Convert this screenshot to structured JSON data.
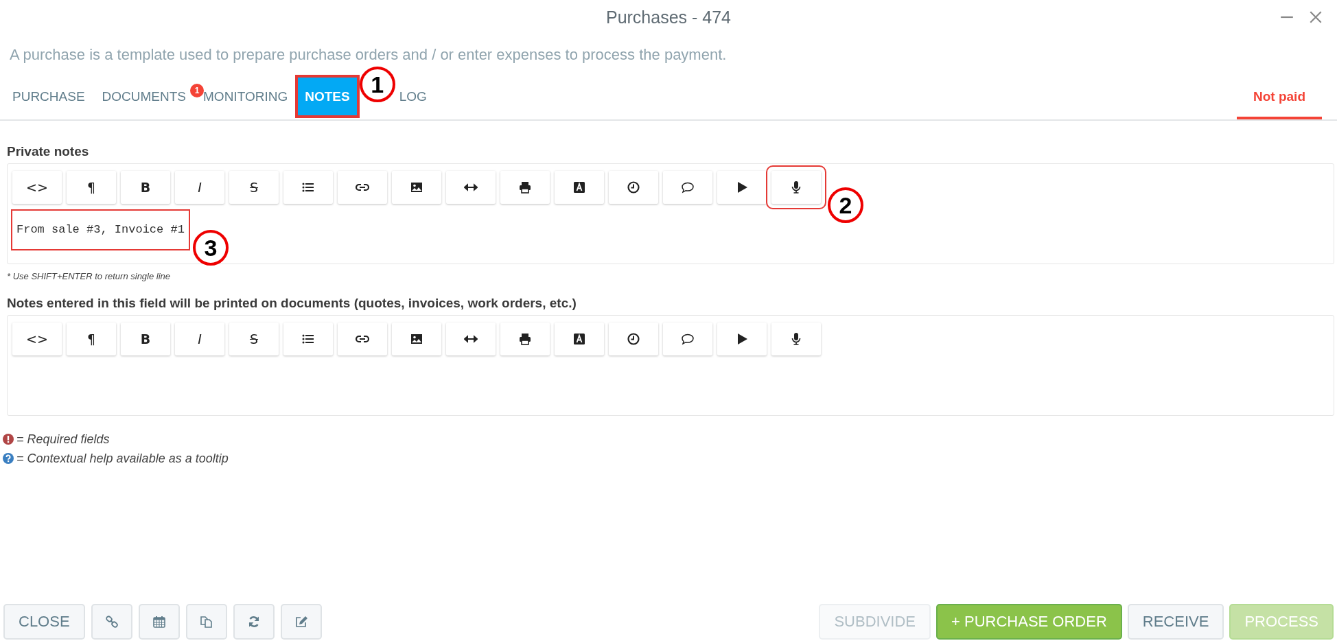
{
  "window": {
    "title": "Purchases - 474"
  },
  "description": "A purchase is a template used to prepare purchase orders and / or enter expenses to process the payment.",
  "tabs": [
    {
      "label": "PURCHASE",
      "selected": false
    },
    {
      "label": "DOCUMENTS",
      "selected": false,
      "badge": "1"
    },
    {
      "label": "MONITORING",
      "selected": false
    },
    {
      "label": "NOTES",
      "selected": true,
      "callout": "1"
    },
    {
      "label": "LOG",
      "selected": false
    }
  ],
  "status": {
    "label": "Not paid"
  },
  "editors": [
    {
      "label": "Private notes",
      "value": "From sale #3, Invoice #1",
      "callout": "3",
      "hint": "* Use SHIFT+ENTER to return single line",
      "toolbar": [
        {
          "kind": "code",
          "glyph": "<>"
        },
        {
          "kind": "paragraph",
          "glyph": "¶"
        },
        {
          "kind": "bold",
          "glyph": "B"
        },
        {
          "kind": "italic",
          "glyph": "I"
        },
        {
          "kind": "strike",
          "glyph": "S"
        },
        {
          "kind": "list"
        },
        {
          "kind": "link"
        },
        {
          "kind": "image"
        },
        {
          "kind": "width"
        },
        {
          "kind": "print"
        },
        {
          "kind": "font"
        },
        {
          "kind": "clock"
        },
        {
          "kind": "comment"
        },
        {
          "kind": "play"
        },
        {
          "kind": "mic",
          "callout": "2"
        }
      ]
    },
    {
      "label": "Notes entered in this field will be printed on documents (quotes, invoices, work orders, etc.)",
      "toolbar": [
        {
          "kind": "code",
          "glyph": "<>"
        },
        {
          "kind": "paragraph",
          "glyph": "¶"
        },
        {
          "kind": "bold",
          "glyph": "B"
        },
        {
          "kind": "italic",
          "glyph": "I"
        },
        {
          "kind": "strike",
          "glyph": "S"
        },
        {
          "kind": "list"
        },
        {
          "kind": "link"
        },
        {
          "kind": "image"
        },
        {
          "kind": "width"
        },
        {
          "kind": "print"
        },
        {
          "kind": "font"
        },
        {
          "kind": "clock"
        },
        {
          "kind": "comment"
        },
        {
          "kind": "play"
        },
        {
          "kind": "mic"
        }
      ]
    }
  ],
  "legend": [
    {
      "kind": "required",
      "text": "= Required fields"
    },
    {
      "kind": "help",
      "text": "= Contextual help available as a tooltip"
    }
  ],
  "footer_left": [
    {
      "kind": "text",
      "label": "CLOSE"
    },
    {
      "kind": "link"
    },
    {
      "kind": "calendar"
    },
    {
      "kind": "copy"
    },
    {
      "kind": "refresh"
    },
    {
      "kind": "edit"
    }
  ],
  "footer_right": [
    {
      "label": "SUBDIVIDE",
      "kind": "default",
      "disabled": true
    },
    {
      "label": "+ PURCHASE ORDER",
      "kind": "primary",
      "disabled": false
    },
    {
      "label": "RECEIVE",
      "kind": "default",
      "disabled": false
    },
    {
      "label": "PROCESS",
      "kind": "primary",
      "disabled": true
    }
  ]
}
